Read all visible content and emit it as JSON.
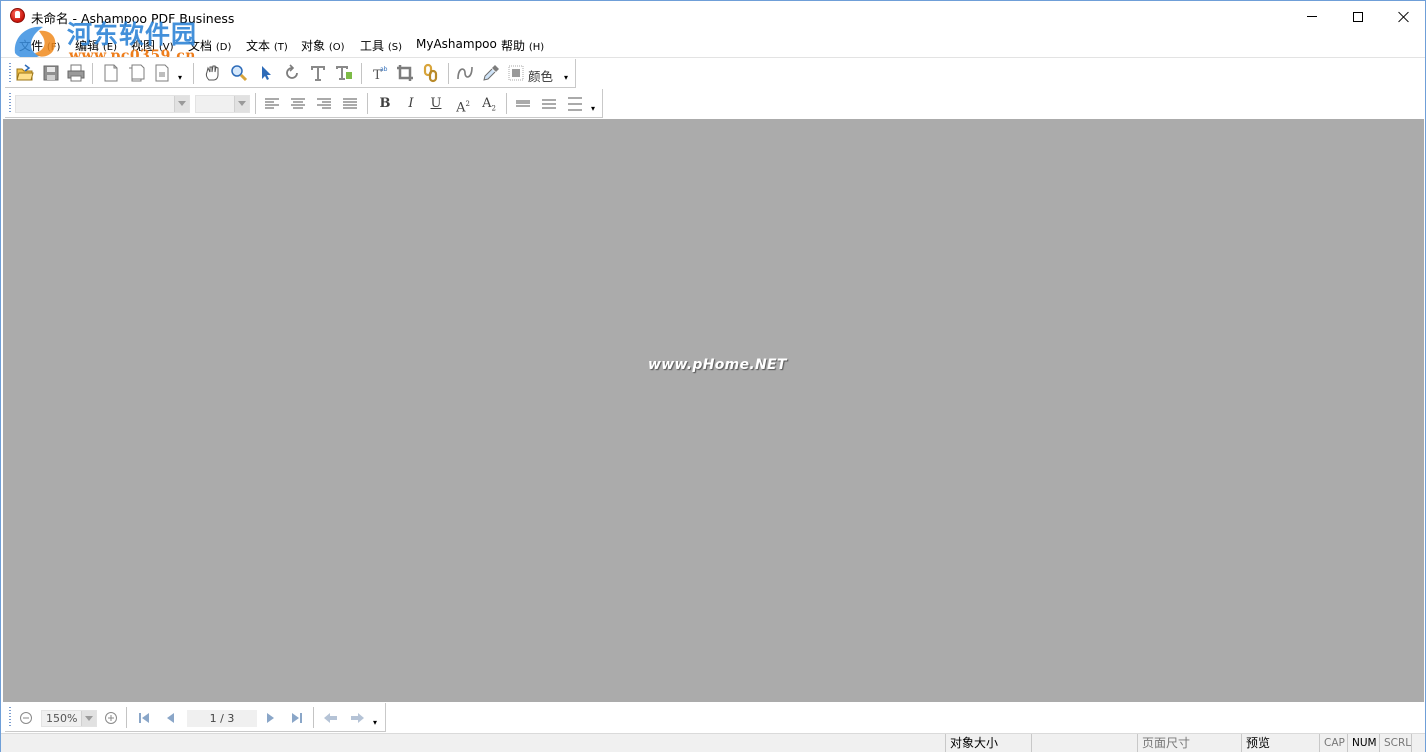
{
  "window": {
    "title": "未命名 - Ashampoo PDF Business",
    "controls": {
      "minimize": "minimize",
      "maximize": "maximize",
      "close": "close"
    }
  },
  "watermark": {
    "site_name": "河东软件园",
    "site_url": "www.pc0359.cn",
    "canvas_mark": "www.pHome.NET"
  },
  "menu": [
    {
      "label": "文件",
      "accel": "(F)"
    },
    {
      "label": "编辑",
      "accel": "(E)"
    },
    {
      "label": "视图",
      "accel": "(V)"
    },
    {
      "label": "文档",
      "accel": "(D)"
    },
    {
      "label": "文本",
      "accel": "(T)"
    },
    {
      "label": "对象",
      "accel": "(O)"
    },
    {
      "label": "工具",
      "accel": "(S)"
    },
    {
      "label": "MyAshampoo",
      "accel": ""
    },
    {
      "label": "帮助",
      "accel": "(H)"
    }
  ],
  "toolbar_main": {
    "icons": [
      "open-folder-icon",
      "save-icon",
      "print-icon",
      "new-page-icon",
      "copy-page-icon",
      "page-options-icon",
      "hand-tool-icon",
      "zoom-tool-icon",
      "select-arrow-icon",
      "rotate-icon",
      "text-tool-icon",
      "text-edit-icon",
      "text-format-icon",
      "crop-icon",
      "link-icon",
      "curve-icon",
      "eyedropper-icon",
      "color-swatch-icon"
    ],
    "color_label": "颜色"
  },
  "toolbar_format": {
    "font_family": "",
    "font_size": "",
    "align": [
      "align-left",
      "align-center",
      "align-right",
      "align-justify"
    ],
    "bold": "B",
    "italic": "I",
    "underline": "U",
    "superscript_base": "A",
    "superscript_exp": "2",
    "subscript_base": "A",
    "subscript_exp": "2"
  },
  "navigation": {
    "zoom_value": "150%",
    "page_indicator": "1 / 3"
  },
  "statusbar": {
    "object_size": "对象大小",
    "page_size": "页面尺寸",
    "preview": "预览",
    "cap": "CAP",
    "num": "NUM",
    "scrl": "SCRL"
  },
  "colors": {
    "canvas_bg": "#ababab",
    "toolbar_icon_blue": "#2d6bb8",
    "toolbar_icon_gray": "#7d7d7d",
    "accent_gold": "#d8a43a"
  }
}
